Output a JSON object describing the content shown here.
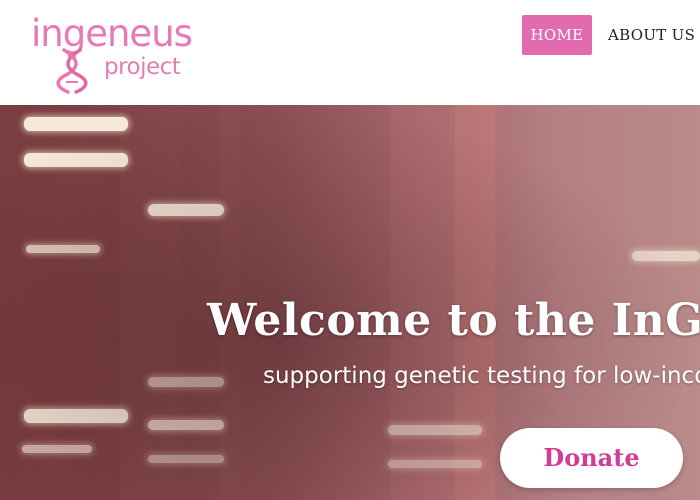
{
  "header": {
    "logo": {
      "word": "ingeneus",
      "sub": "project"
    },
    "nav": [
      {
        "label": "HOME"
      },
      {
        "label": "ABOUT US"
      }
    ]
  },
  "hero": {
    "title": "Welcome to the InGEN",
    "subtitle": "supporting genetic testing for low-inco",
    "donate_label": "Donate"
  },
  "colors": {
    "brand_pink": "#e26bb0",
    "donate_text": "#d33b95",
    "logo_pink": "#e879b6"
  }
}
